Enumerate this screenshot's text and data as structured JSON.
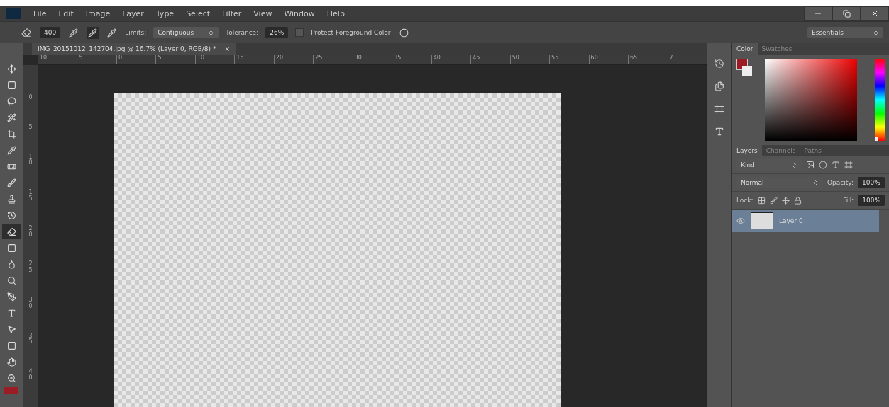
{
  "menu": [
    "File",
    "Edit",
    "Image",
    "Layer",
    "Type",
    "Select",
    "Filter",
    "View",
    "Window",
    "Help"
  ],
  "options_bar": {
    "brush_size": "400",
    "limits_label": "Limits:",
    "limits": "Contiguous",
    "tolerance_label": "Tolerance:",
    "tolerance": "26%",
    "protect_foreground": {
      "label": "Protect Foreground Color",
      "checked": false
    },
    "sampling": [
      {
        "selected": false
      },
      {
        "selected": true
      },
      {
        "selected": false
      }
    ]
  },
  "workspace": "Essentials",
  "document_tab": {
    "title": "IMG_20151012_142704.jpg @ 16.7% (Layer 0, RGB/8) *",
    "close": "×"
  },
  "ruler_h": [
    "10",
    "5",
    "0",
    "5",
    "10",
    "15",
    "20",
    "25",
    "30",
    "35",
    "40",
    "45",
    "50",
    "55",
    "60",
    "65",
    "7"
  ],
  "ruler_v": [
    "0",
    "5",
    "10",
    "15",
    "20",
    "25",
    "30",
    "35",
    "40"
  ],
  "tools": [
    {
      "selected": false
    },
    {
      "selected": false
    },
    {
      "selected": false
    },
    {
      "selected": false
    },
    {
      "selected": false
    },
    {
      "selected": false
    },
    {
      "selected": false
    },
    {
      "selected": false
    },
    {
      "selected": false
    },
    {
      "selected": false
    },
    {
      "selected": true
    },
    {
      "selected": false
    },
    {
      "selected": false
    },
    {
      "selected": false
    },
    {
      "selected": false
    },
    {
      "selected": false
    },
    {
      "selected": false
    },
    {
      "selected": false
    },
    {
      "selected": false
    },
    {
      "selected": false
    }
  ],
  "swatches": [
    {
      "kind": "foreground",
      "color": "#9b1c24"
    },
    {
      "kind": "background",
      "color": "#eeeeee"
    }
  ],
  "color_panel": {
    "tabs": [
      {
        "label": "Color",
        "selected": true
      },
      {
        "label": "Swatches",
        "selected": false
      }
    ],
    "hue_slider": {
      "level": 0
    }
  },
  "layers_panel": {
    "tabs": [
      {
        "label": "Layers",
        "selected": true
      },
      {
        "label": "Channels",
        "selected": false
      },
      {
        "label": "Paths",
        "selected": false
      }
    ],
    "filter": "Kind",
    "blend_mode": "Normal",
    "opacity_label": "Opacity:",
    "opacity": "100%",
    "lock_label": "Lock:",
    "fill_label": "Fill:",
    "fill": "100%",
    "layers": [
      {
        "name": "Layer 0",
        "visible": true,
        "selected": true
      }
    ]
  }
}
